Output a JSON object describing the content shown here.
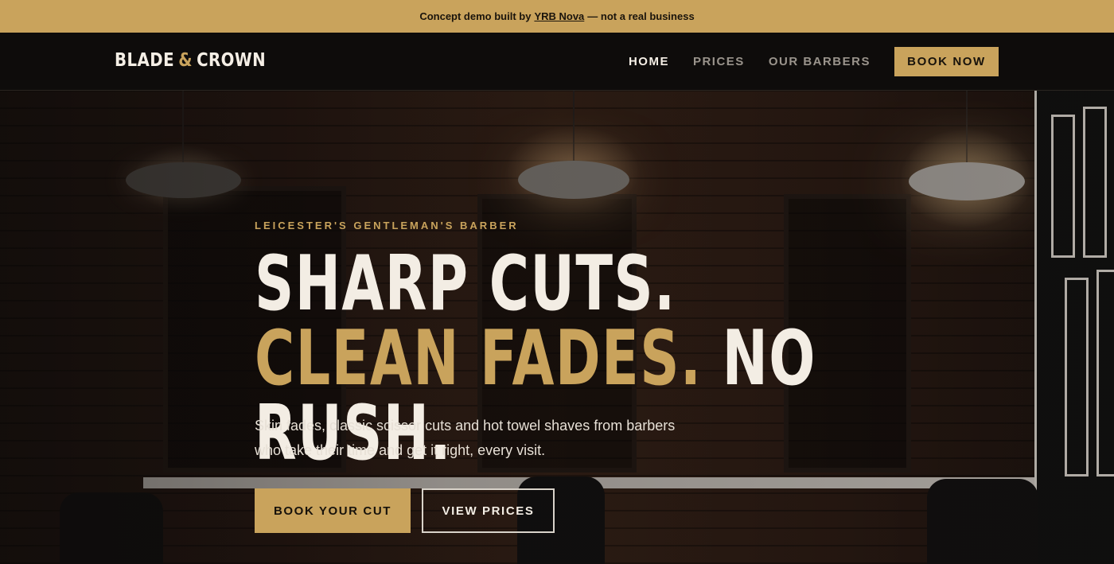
{
  "banner": {
    "prefix": "Concept demo built by",
    "link": "YRB Nova",
    "suffix": "— not a real business"
  },
  "brand": {
    "name_part1": "BLADE",
    "amp": "&",
    "name_part2": "CROWN",
    "accent_color": "#c9a35c"
  },
  "nav": {
    "items": [
      {
        "label": "HOME",
        "active": true
      },
      {
        "label": "PRICES",
        "active": false
      },
      {
        "label": "OUR BARBERS",
        "active": false
      }
    ],
    "cta": "BOOK NOW"
  },
  "hero": {
    "eyebrow": "LEICESTER'S GENTLEMAN'S BARBER",
    "headline_part1": "SHARP CUTS.",
    "headline_part2": "CLEAN FADES.",
    "headline_part3": "NO RUSH.",
    "subtext": "Skin fades, classic scissor cuts and hot towel shaves from barbers who take their time and get it right, every visit.",
    "primary_cta": "BOOK YOUR CUT",
    "secondary_cta": "VIEW PRICES"
  }
}
